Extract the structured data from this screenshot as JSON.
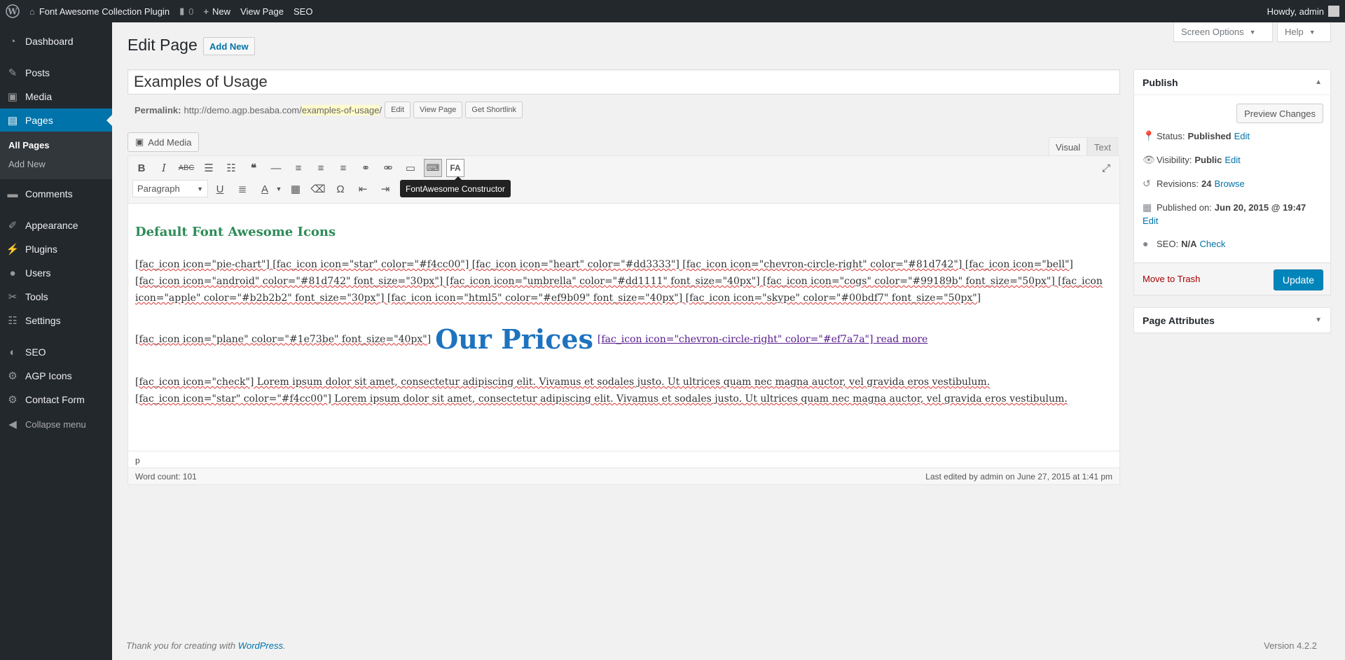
{
  "adminbar": {
    "site_name": "Font Awesome Collection Plugin",
    "comments_count": "0",
    "new_label": "New",
    "view_page": "View Page",
    "seo": "SEO",
    "howdy": "Howdy, admin"
  },
  "sidebar": {
    "dashboard": "Dashboard",
    "posts": "Posts",
    "media": "Media",
    "pages": "Pages",
    "all_pages": "All Pages",
    "add_new": "Add New",
    "comments": "Comments",
    "appearance": "Appearance",
    "plugins": "Plugins",
    "users": "Users",
    "tools": "Tools",
    "settings": "Settings",
    "seo": "SEO",
    "agp_icons": "AGP Icons",
    "contact_form": "Contact Form",
    "collapse": "Collapse menu"
  },
  "header": {
    "screen_options": "Screen Options",
    "help": "Help",
    "title": "Edit Page",
    "add_new": "Add New"
  },
  "post": {
    "title": "Examples of Usage",
    "permalink_label": "Permalink:",
    "permalink_base": "http://demo.agp.besaba.com/",
    "permalink_slug": "examples-of-usage",
    "permalink_end": "/",
    "edit_btn": "Edit",
    "view_page_btn": "View Page",
    "shortlink_btn": "Get Shortlink"
  },
  "editor": {
    "add_media": "Add Media",
    "tab_visual": "Visual",
    "tab_text": "Text",
    "format": "Paragraph",
    "tooltip": "FontAwesome Constructor",
    "heading": "Default Font Awesome Icons",
    "para1": "[fac_icon icon=\"pie-chart\"] [fac_icon icon=\"star\" color=\"#f4cc00\"] [fac_icon icon=\"heart\" color=\"#dd3333\"] [fac_icon icon=\"chevron-circle-right\" color=\"#81d742\"] [fac_icon icon=\"bell\"] [fac_icon icon=\"android\" color=\"#81d742\" font_size=\"30px\"] [fac_icon icon=\"umbrella\" color=\"#dd1111\" font_size=\"40px\"] [fac_icon icon=\"cogs\" color=\"#99189b\" font_size=\"50px\"] [fac_icon icon=\"apple\" color=\"#b2b2b2\" font_size=\"30px\"] [fac_icon icon=\"html5\" color=\"#ef9b09\" font_size=\"40px\"] [fac_icon icon=\"skype\" color=\"#00bdf7\" font_size=\"50px\"]",
    "para2_pre": "[fac_icon icon=\"plane\" color=\"#1e73be\" font_size=\"40px\"]",
    "para2_big": "Our Prices",
    "para2_link": "[fac_icon icon=\"chevron-circle-right\" color=\"#ef7a7a\"] read more",
    "para3_line1": "[fac_icon icon=\"check\"] Lorem ipsum dolor sit amet, consectetur adipiscing elit. Vivamus et sodales justo. Ut ultrices quam nec magna auctor, vel gravida eros vestibulum.",
    "para3_line2": "[fac_icon icon=\"star\" color=\"#f4cc00\"] Lorem ipsum dolor sit amet, consectetur adipiscing elit. Vivamus et sodales justo. Ut ultrices quam nec magna auctor, vel gravida eros vestibulum.",
    "path": "p",
    "word_count": "Word count: 101",
    "last_edited": "Last edited by admin on June 27, 2015 at 1:41 pm"
  },
  "publish": {
    "title": "Publish",
    "preview": "Preview Changes",
    "status_label": "Status:",
    "status_value": "Published",
    "visibility_label": "Visibility:",
    "visibility_value": "Public",
    "revisions_label": "Revisions:",
    "revisions_value": "24",
    "browse": "Browse",
    "published_label": "Published on:",
    "published_value": "Jun 20, 2015 @ 19:47",
    "seo_label": "SEO:",
    "seo_value": "N/A",
    "check": "Check",
    "edit": "Edit",
    "trash": "Move to Trash",
    "update": "Update"
  },
  "page_attributes": {
    "title": "Page Attributes"
  },
  "footer": {
    "thanks_pre": "Thank you for creating with",
    "wordpress": "WordPress",
    "thanks_post": ".",
    "version": "Version 4.2.2"
  },
  "colors": {
    "accent": "#0073aa",
    "adminbar": "#23282d",
    "heading_green": "#2e8b57",
    "our_prices_blue": "#1e73be"
  }
}
